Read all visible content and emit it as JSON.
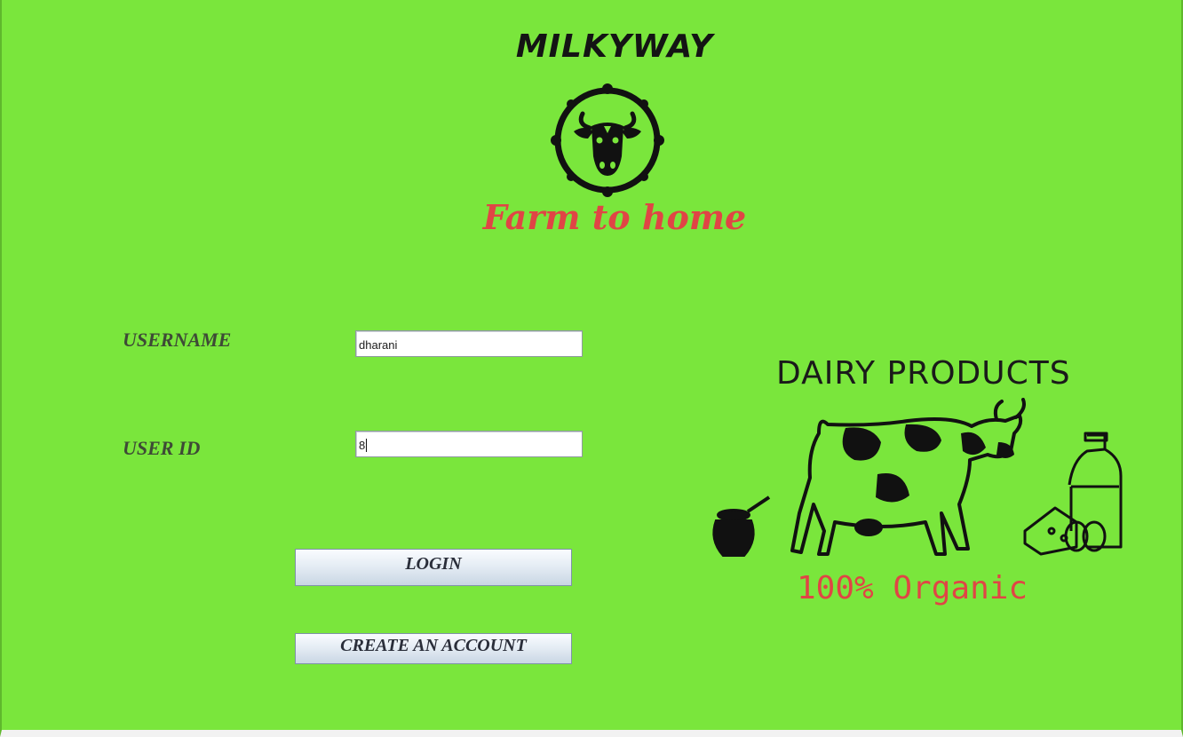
{
  "brand": {
    "title": "MILKYWAY",
    "tagline": "Farm to home",
    "logo_icon": "cow-head-icon"
  },
  "form": {
    "username_label": "USERNAME",
    "username_value": "dharani",
    "userid_label": "USER ID",
    "userid_value": "8",
    "login_label": "LOGIN",
    "create_label": "CREATE AN ACCOUNT"
  },
  "promo": {
    "title": "DAIRY PRODUCTS",
    "subtitle": "100% Organic",
    "illustration_icon": "dairy-cow-icon"
  },
  "colors": {
    "background": "#7ae63c",
    "accent_red": "#e04545",
    "text_dark": "#3e4a36"
  }
}
